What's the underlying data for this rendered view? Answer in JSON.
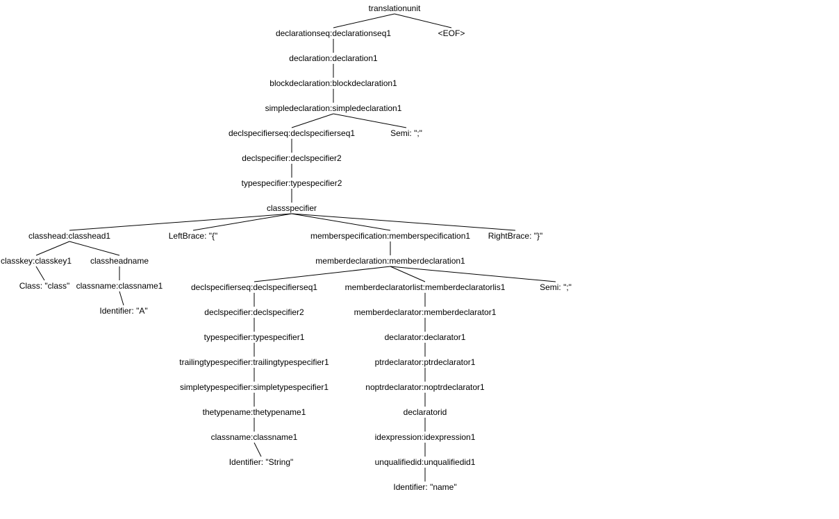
{
  "nodes": {
    "translationunit": "translationunit",
    "declarationseq": "declarationseq:declarationseq1",
    "eof": "<EOF>",
    "declaration": "declaration:declaration1",
    "blockdeclaration": "blockdeclaration:blockdeclaration1",
    "simpledeclaration": "simpledeclaration:simpledeclaration1",
    "declspecifierseq_top": "declspecifierseq:declspecifierseq1",
    "semi_top": "Semi: \";\"",
    "declspecifier_top": "declspecifier:declspecifier2",
    "typespecifier2": "typespecifier:typespecifier2",
    "classspecifier": "classspecifier",
    "classhead": "classhead:classhead1",
    "leftbrace": "LeftBrace: \"{\"",
    "memberspecification": "memberspecification:memberspecification1",
    "rightbrace": "RightBrace: \"}\"",
    "classkey": "classkey:classkey1",
    "classheadname": "classheadname",
    "class_kw": "Class: \"class\"",
    "classname_A": "classname:classname1",
    "identifier_A": "Identifier: \"A\"",
    "memberdeclaration": "memberdeclaration:memberdeclaration1",
    "declspecifierseq_member": "declspecifierseq:declspecifierseq1",
    "memberdeclaratorlist": "memberdeclaratorlist:memberdeclaratorlis1",
    "semi_member": "Semi: \";\"",
    "declspecifier_member": "declspecifier:declspecifier2",
    "typespecifier1": "typespecifier:typespecifier1",
    "trailingtypespecifier": "trailingtypespecifier:trailingtypespecifier1",
    "simpletypespecifier": "simpletypespecifier:simpletypespecifier1",
    "thetypename": "thetypename:thetypename1",
    "classname_String": "classname:classname1",
    "identifier_String": "Identifier: \"String\"",
    "memberdeclarator": "memberdeclarator:memberdeclarator1",
    "declarator": "declarator:declarator1",
    "ptrdeclarator": "ptrdeclarator:ptrdeclarator1",
    "noptrdeclarator": "noptrdeclarator:noptrdeclarator1",
    "declaratorid": "declaratorid",
    "idexpression": "idexpression:idexpression1",
    "unqualifiedid": "unqualifiedid:unqualifiedid1",
    "identifier_name": "Identifier: \"name\""
  }
}
